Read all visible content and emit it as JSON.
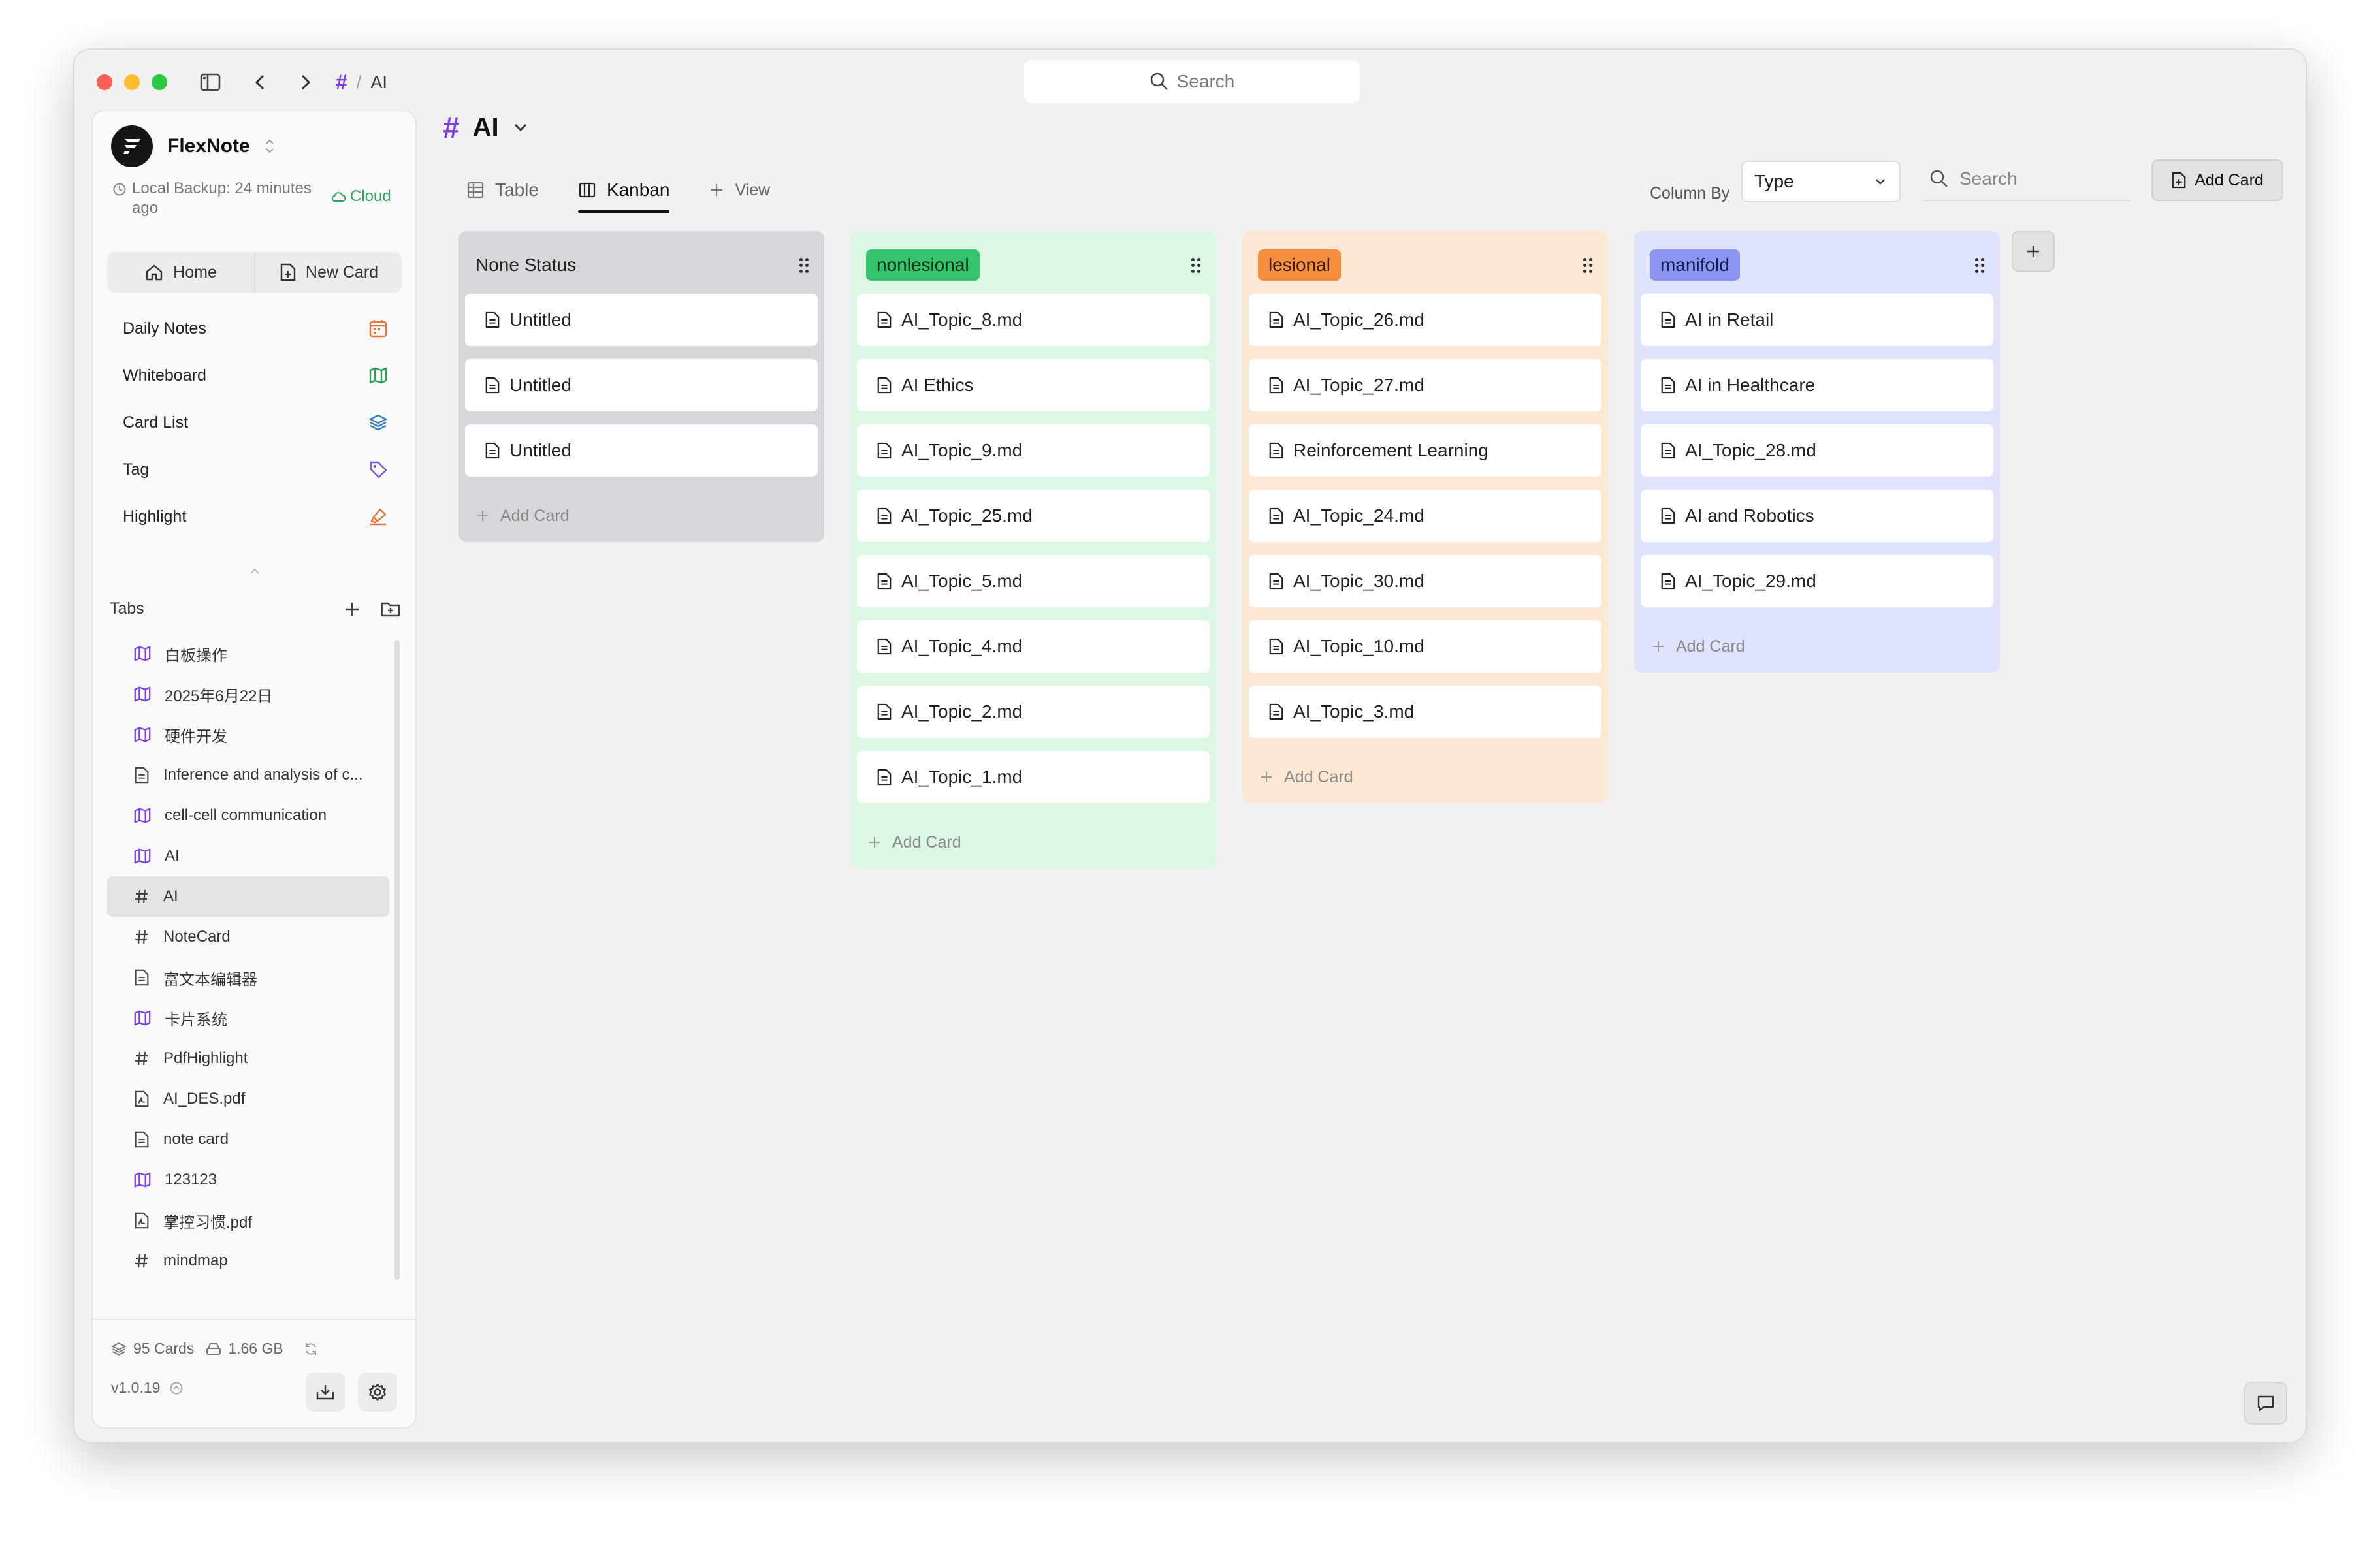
{
  "breadcrumb": {
    "separator": "/",
    "current": "AI"
  },
  "top_search": {
    "placeholder": "Search"
  },
  "brand": {
    "name": "FlexNote",
    "backup_text": "Local Backup: 24 minutes ago",
    "cloud_label": "Cloud"
  },
  "quick": {
    "home": "Home",
    "new_card": "New Card"
  },
  "nav": [
    {
      "label": "Daily Notes",
      "icon": "calendar-icon",
      "color": "#e8743b"
    },
    {
      "label": "Whiteboard",
      "icon": "map-icon",
      "color": "#2e9e5b"
    },
    {
      "label": "Card List",
      "icon": "layers-icon",
      "color": "#3b82c4"
    },
    {
      "label": "Tag",
      "icon": "tag-icon",
      "color": "#7b5cd6"
    },
    {
      "label": "Highlight",
      "icon": "highlighter-icon",
      "color": "#e8743b"
    }
  ],
  "tabs": {
    "title": "Tabs",
    "items": [
      {
        "label": "白板操作",
        "icon": "map-icon"
      },
      {
        "label": "2025年6月22日",
        "icon": "map-icon"
      },
      {
        "label": "硬件开发",
        "icon": "map-icon"
      },
      {
        "label": "Inference and analysis of c...",
        "icon": "document-icon"
      },
      {
        "label": "cell-cell communication",
        "icon": "map-icon"
      },
      {
        "label": "AI",
        "icon": "map-icon"
      },
      {
        "label": "AI",
        "icon": "hash-icon",
        "active": true
      },
      {
        "label": "NoteCard",
        "icon": "hash-icon"
      },
      {
        "label": "富文本编辑器",
        "icon": "document-icon"
      },
      {
        "label": "卡片系统",
        "icon": "map-icon"
      },
      {
        "label": "PdfHighlight",
        "icon": "hash-icon"
      },
      {
        "label": "AI_DES.pdf",
        "icon": "pdf-icon"
      },
      {
        "label": "note card",
        "icon": "document-icon"
      },
      {
        "label": "123123",
        "icon": "map-icon"
      },
      {
        "label": "掌控习惯.pdf",
        "icon": "pdf-icon"
      },
      {
        "label": "mindmap",
        "icon": "hash-icon"
      }
    ]
  },
  "footer": {
    "cards": "95 Cards",
    "size": "1.66 GB",
    "version": "v1.0.19"
  },
  "page": {
    "title": "AI"
  },
  "views": {
    "table": "Table",
    "kanban": "Kanban",
    "add_view": "View"
  },
  "toolbar": {
    "column_by_label": "Column By",
    "column_by_value": "Type",
    "search_placeholder": "Search",
    "add_card": "Add Card"
  },
  "add_card_label": "Add Card",
  "columns": [
    {
      "title": "None Status",
      "pill_bg": "",
      "pill_color": "#222",
      "col_bg": "#d7d7db",
      "cards": [
        "Untitled",
        "Untitled",
        "Untitled"
      ]
    },
    {
      "title": "nonlesional",
      "pill_bg": "#34c46b",
      "pill_color": "#0b2e16",
      "col_bg": "#dcf8e5",
      "cards": [
        "AI_Topic_8.md",
        "AI Ethics",
        "AI_Topic_9.md",
        "AI_Topic_25.md",
        "AI_Topic_5.md",
        "AI_Topic_4.md",
        "AI_Topic_2.md",
        "AI_Topic_1.md"
      ]
    },
    {
      "title": "lesional",
      "pill_bg": "#f7903e",
      "pill_color": "#3a1a04",
      "col_bg": "#fde9d3",
      "cards": [
        "AI_Topic_26.md",
        "AI_Topic_27.md",
        "Reinforcement Learning",
        "AI_Topic_24.md",
        "AI_Topic_30.md",
        "AI_Topic_10.md",
        "AI_Topic_3.md"
      ]
    },
    {
      "title": "manifold",
      "pill_bg": "#8b96f2",
      "pill_color": "#111a4a",
      "col_bg": "#dfe3fb",
      "cards": [
        "AI in Retail",
        "AI in Healthcare",
        "AI_Topic_28.md",
        "AI and Robotics",
        "AI_Topic_29.md"
      ]
    }
  ]
}
